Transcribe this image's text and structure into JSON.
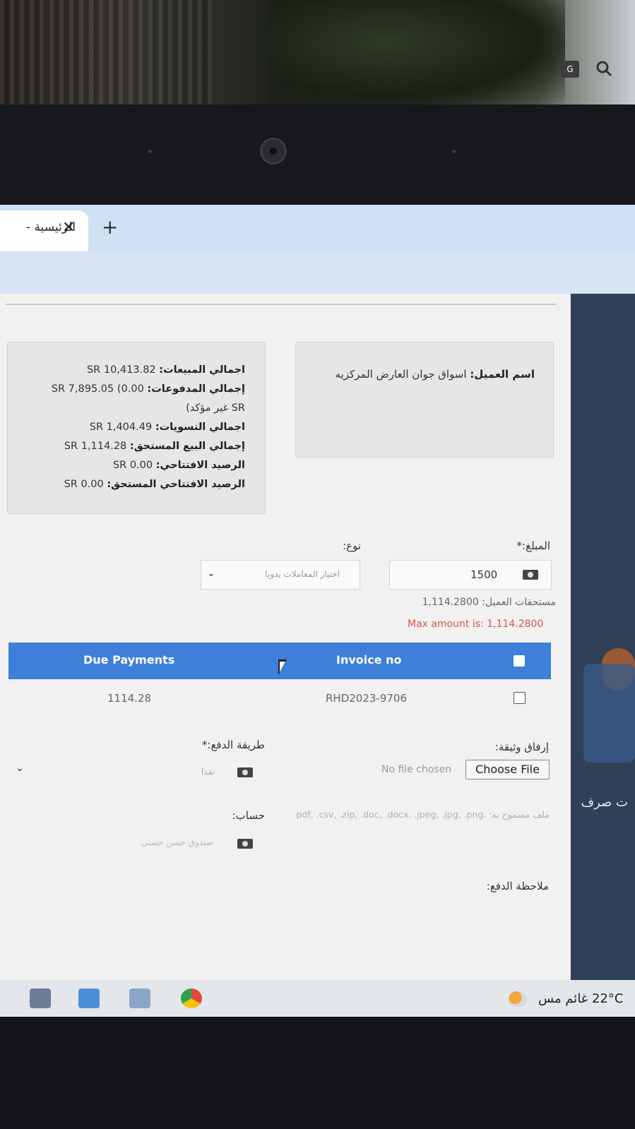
{
  "browser": {
    "tab_title": "الرئيسية -",
    "tab_close": "✕",
    "new_tab": "+"
  },
  "customer_card": {
    "name_label": "اسم العميل:",
    "name_value": "اسواق جوان العارض المركزيه"
  },
  "totals_card": {
    "sales_label": "اجمالي المبيعات:",
    "sales_value": "SR 10,413.82",
    "payments_label": "إجمالي المدفوعات:",
    "payments_value": "SR 7,895.05 (0.00",
    "payments_unconfirmed": "SR غير مؤكد)",
    "settlements_label": "اجمالي التسويات:",
    "settlements_value": "SR 1,404.49",
    "due_label": "إجمالي البيع المستحق:",
    "due_value": "SR 1,114.28",
    "opening_label": "الرصيد الافتتاحي:",
    "opening_value": "SR 0.00",
    "opening_due_label": "الرصيد الافتتاحي المستحق:",
    "opening_due_value": "SR 0.00"
  },
  "form": {
    "amount_label": "المبلغ:*",
    "amount_value": "1500",
    "type_label": "نوع:",
    "type_placeholder": "اختيار المعاملات يدويا",
    "customer_dues_label": "مستحقات العميل:",
    "customer_dues_value": "1,114.2800",
    "max_amount": "Max amount is: 1,114.2800",
    "attach_label": "إرفاق وثيقة:",
    "no_file": "No file chosen",
    "choose_file": "Choose File",
    "file_hint": "ملف مسموح به: .pdf, .csv, .zip, .doc, .docx, .jpeg, .jpg, .png",
    "payment_method_label": "طريقة الدفع:*",
    "payment_method_value": "نقدا",
    "account_label": "حساب:",
    "account_value": "صندوق حسن حسني",
    "payment_note_label": "ملاحظة الدفع:"
  },
  "table": {
    "headers": [
      "Invoice no",
      "Due Payments"
    ],
    "rows": [
      {
        "invoice": "RHD2023-9706",
        "due": "1114.28"
      }
    ]
  },
  "sidebar": {
    "label": "ت صرف"
  },
  "taskbar": {
    "weather": "22°C غائم",
    "weather_suffix": "مس"
  },
  "colors": {
    "table_header": "#3d7fd9",
    "error": "#d9534f",
    "sidebar": "#2f4057",
    "tabbar": "#cfe0f3"
  }
}
